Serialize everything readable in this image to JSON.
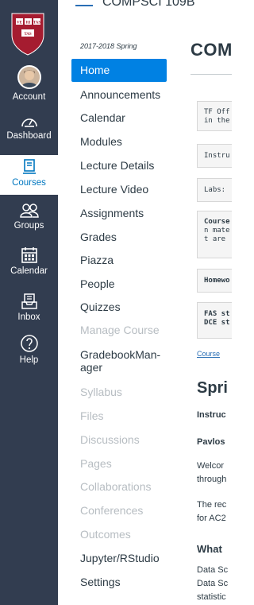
{
  "header": {
    "breadcrumb": "COMPSCI 109B"
  },
  "global_nav": {
    "logo": "VE RI TAS",
    "items": [
      {
        "label": "Account",
        "icon": "avatar"
      },
      {
        "label": "Dashboard",
        "icon": "dashboard-icon"
      },
      {
        "label": "Courses",
        "icon": "courses-icon",
        "active": true
      },
      {
        "label": "Groups",
        "icon": "groups-icon"
      },
      {
        "label": "Calendar",
        "icon": "calendar-icon"
      },
      {
        "label": "Inbox",
        "icon": "inbox-icon"
      },
      {
        "label": "Help",
        "icon": "help-icon"
      }
    ],
    "colors": {
      "background": "#323d50",
      "active_text": "#0077c0"
    }
  },
  "course_nav": {
    "term": "2017-2018 Spring",
    "items": [
      {
        "label": "Home",
        "state": "active"
      },
      {
        "label": "Announcements",
        "state": "normal"
      },
      {
        "label": "Calendar",
        "state": "normal"
      },
      {
        "label": "Modules",
        "state": "normal"
      },
      {
        "label": "Lecture Details",
        "state": "normal"
      },
      {
        "label": "Lecture Video",
        "state": "normal"
      },
      {
        "label": "Assignments",
        "state": "normal"
      },
      {
        "label": "Grades",
        "state": "normal"
      },
      {
        "label": "Piazza",
        "state": "normal"
      },
      {
        "label": "People",
        "state": "normal"
      },
      {
        "label": "Quizzes",
        "state": "normal"
      },
      {
        "label": "Manage Course",
        "state": "disabled"
      },
      {
        "label": "GradebookMan-",
        "label_line2": "ager",
        "state": "normal"
      },
      {
        "label": "Syllabus",
        "state": "disabled"
      },
      {
        "label": "Files",
        "state": "disabled"
      },
      {
        "label": "Discussions",
        "state": "disabled"
      },
      {
        "label": "Pages",
        "state": "disabled"
      },
      {
        "label": "Collaborations",
        "state": "disabled"
      },
      {
        "label": "Conferences",
        "state": "disabled"
      },
      {
        "label": "Outcomes",
        "state": "disabled"
      },
      {
        "label": "Jupyter/RStudio",
        "state": "normal"
      },
      {
        "label": "Settings",
        "state": "normal"
      }
    ],
    "colors": {
      "active_bg": "#0081e3",
      "disabled_text": "#b7bdc2"
    }
  },
  "main": {
    "title": "COM",
    "boxes": [
      {
        "lines": [
          "TF Off",
          "in the"
        ]
      },
      {
        "lines": [
          "Instru"
        ]
      },
      {
        "lines": [
          "Labs:"
        ]
      },
      {
        "lines": [
          "Course",
          "n mate",
          "t are"
        ]
      },
      {
        "lines": [
          "Homewo"
        ]
      },
      {
        "lines": [
          "FAS st",
          "DCE st"
        ],
        "bold": true
      }
    ],
    "link": "Course",
    "heading": "Spri",
    "instructors_label": "Instruc",
    "pavlos_label": "Pavlos",
    "welcome_lines": [
      "Welcor",
      "through"
    ],
    "rec_lines": [
      "The rec",
      "for AC2"
    ],
    "what_heading": "What",
    "data_lines": [
      "Data Sc",
      "Data Sc",
      "statistic"
    ]
  }
}
